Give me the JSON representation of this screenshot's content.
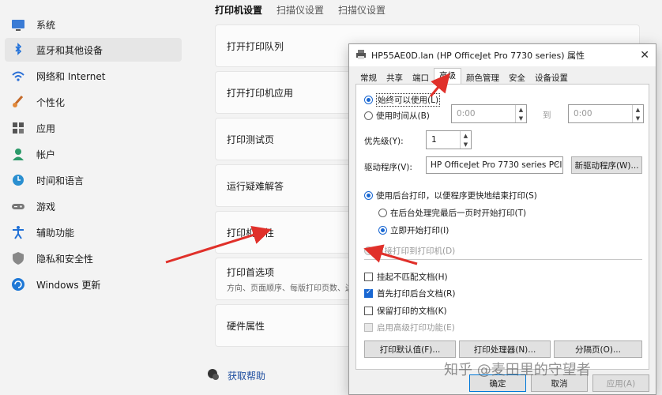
{
  "nav": {
    "items": [
      {
        "label": "系统",
        "icon": "monitor-icon"
      },
      {
        "label": "蓝牙和其他设备",
        "icon": "bluetooth-icon",
        "selected": true
      },
      {
        "label": "网络和 Internet",
        "icon": "wifi-icon"
      },
      {
        "label": "个性化",
        "icon": "brush-icon"
      },
      {
        "label": "应用",
        "icon": "apps-icon"
      },
      {
        "label": "帐户",
        "icon": "account-icon"
      },
      {
        "label": "时间和语言",
        "icon": "globe-clock-icon"
      },
      {
        "label": "游戏",
        "icon": "gamepad-icon"
      },
      {
        "label": "辅助功能",
        "icon": "accessibility-icon"
      },
      {
        "label": "隐私和安全性",
        "icon": "shield-icon"
      },
      {
        "label": "Windows 更新",
        "icon": "update-icon"
      }
    ]
  },
  "main": {
    "tabs": [
      "打印机设置",
      "扫描仪设置",
      "扫描仪设置"
    ],
    "cards": [
      {
        "title": "打开打印队列"
      },
      {
        "title": "打开打印机应用"
      },
      {
        "title": "打印测试页"
      },
      {
        "title": "运行疑难解答"
      },
      {
        "title": "打印机属性"
      },
      {
        "title": "打印首选项",
        "subtitle": "方向、页面顺序、每版打印页数、边"
      },
      {
        "title": "硬件属性"
      }
    ],
    "help_label": "获取帮助"
  },
  "dialog": {
    "title": "HP55AE0D.lan (HP OfficeJet Pro 7730 series) 属性",
    "tabs": [
      "常规",
      "共享",
      "端口",
      "高级",
      "颜色管理",
      "安全",
      "设备设置"
    ],
    "active_tab": "高级",
    "always_available_label": "始终可以使用(L)",
    "use_time_label": "使用时间从(B)",
    "time_from": "0:00",
    "to_label": "到",
    "time_to": "0:00",
    "priority_label": "优先级(Y):",
    "priority_value": "1",
    "driver_label": "驱动程序(V):",
    "driver_value": "HP OfficeJet Pro 7730 series PCI",
    "new_driver_button": "新驱动程序(W)...",
    "spool_label": "使用后台打印，以便程序更快地结束打印(S)",
    "spool_after_last_label": "在后台处理完最后一页时开始打印(T)",
    "spool_immediate_label": "立即开始打印(I)",
    "direct_print_label": "直接打印到打印机(D)",
    "hold_mismatched_label": "挂起不匹配文档(H)",
    "print_spooled_first_label": "首先打印后台文档(R)",
    "keep_printed_label": "保留打印的文档(K)",
    "advanced_features_label": "启用高级打印功能(E)",
    "defaults_button": "打印默认值(F)...",
    "processor_button": "打印处理器(N)...",
    "separator_button": "分隔页(O)...",
    "ok_button": "确定",
    "cancel_button": "取消",
    "apply_button": "应用(A)"
  },
  "watermark": "知乎 @麦田里的守望者",
  "colors": {
    "accent": "#1967d2",
    "annotation_arrow": "#e0302a"
  }
}
